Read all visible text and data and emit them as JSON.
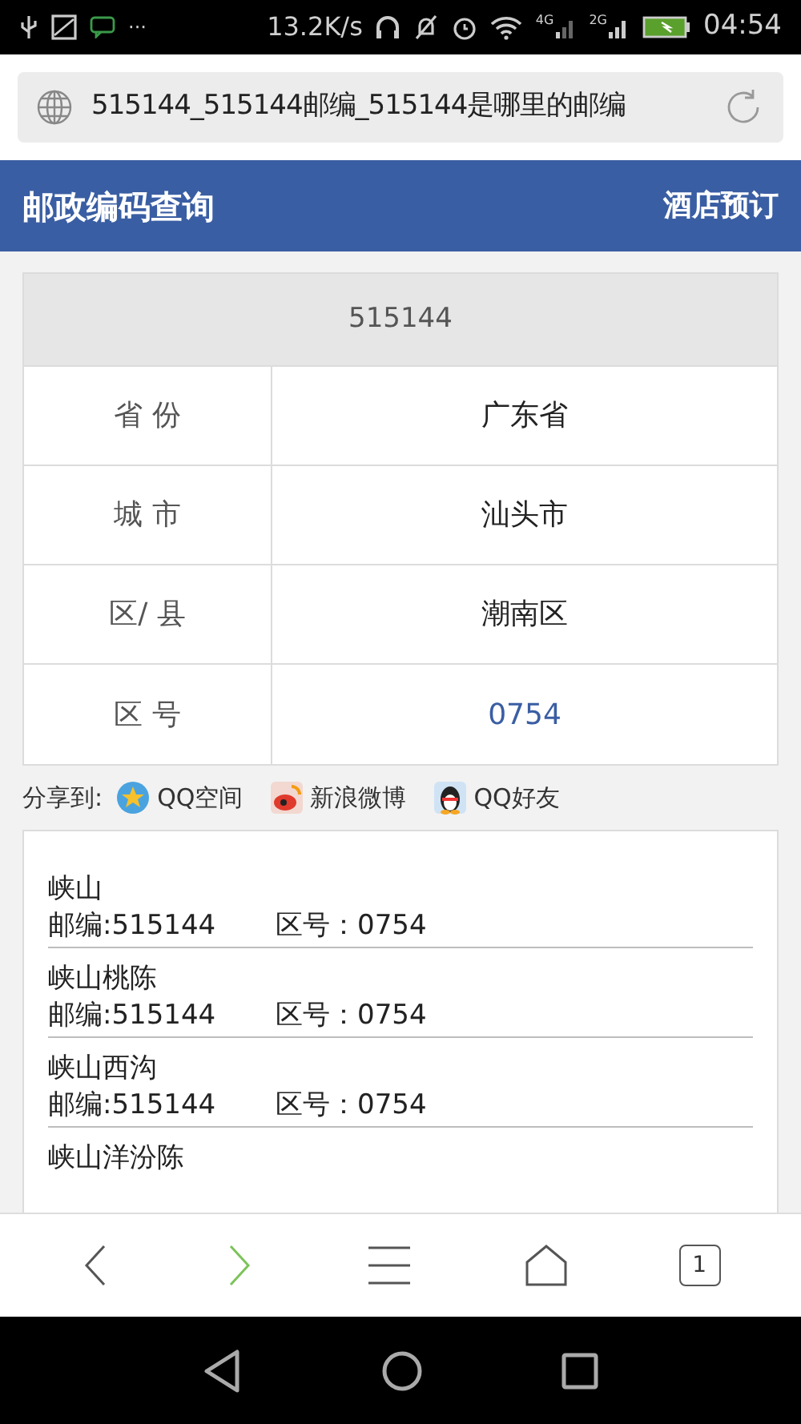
{
  "status_bar": {
    "speed": "13.2K/s",
    "net1": "4G",
    "net2": "2G",
    "time": "04:54",
    "notif_more": "···"
  },
  "address_bar": {
    "title": "515144_515144邮编_515144是哪里的邮编"
  },
  "header": {
    "title": "邮政编码查询",
    "link": "酒店预订"
  },
  "table": {
    "heading": "515144",
    "rows": [
      {
        "label": "省 份",
        "value": "广东省",
        "link": false
      },
      {
        "label": "城 市",
        "value": "汕头市",
        "link": false
      },
      {
        "label": "区/ 县",
        "value": "潮南区",
        "link": false
      },
      {
        "label": "区 号",
        "value": "0754",
        "link": true
      }
    ]
  },
  "share": {
    "label": "分享到:",
    "targets": [
      {
        "kind": "qzone",
        "label": "QQ空间"
      },
      {
        "kind": "weibo",
        "label": "新浪微博"
      },
      {
        "kind": "qq",
        "label": "QQ好友"
      }
    ]
  },
  "places": [
    {
      "name": "峡山",
      "postcode": "邮编:515144",
      "area_code": "区号：0754"
    },
    {
      "name": "峡山桃陈",
      "postcode": "邮编:515144",
      "area_code": "区号：0754"
    },
    {
      "name": "峡山西沟",
      "postcode": "邮编:515144",
      "area_code": "区号：0754"
    },
    {
      "name": "峡山洋汾陈"
    }
  ],
  "browser_bar": {
    "tab_count": "1"
  }
}
